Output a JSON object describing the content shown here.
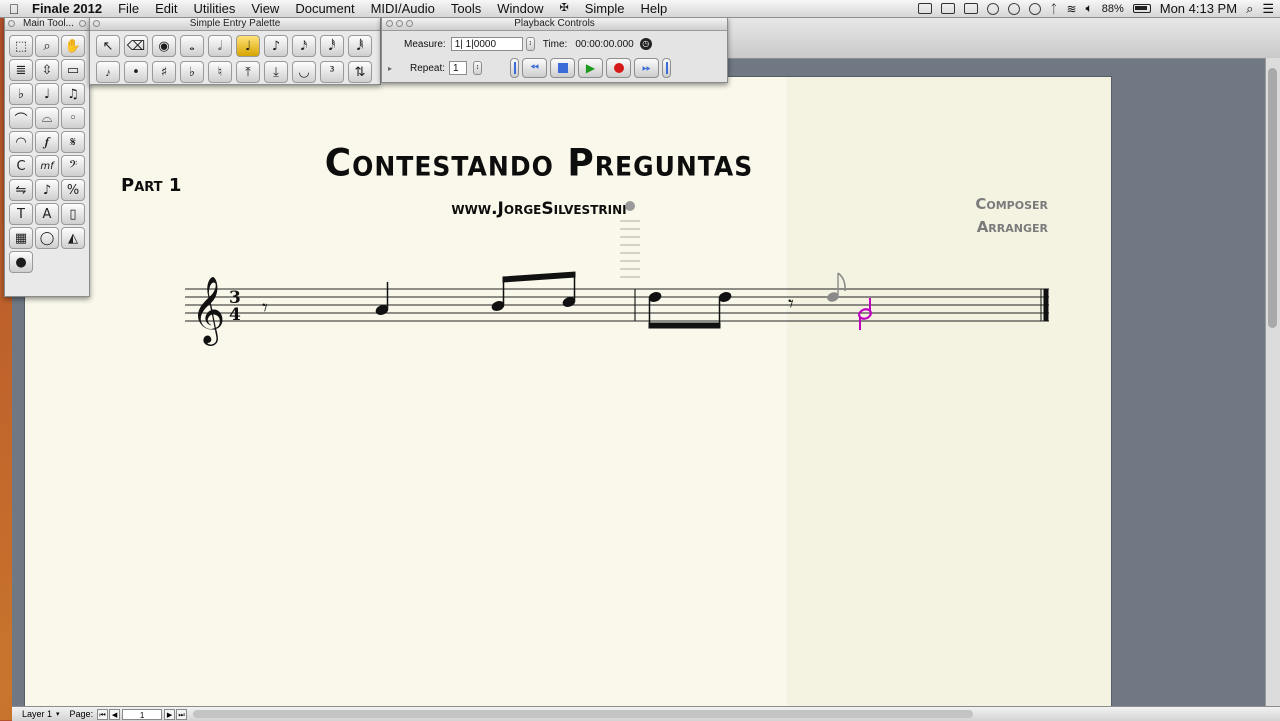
{
  "menubar": {
    "app_name": "Finale 2012",
    "items": [
      "File",
      "Edit",
      "Utilities",
      "View",
      "Document",
      "MIDI/Audio",
      "Tools",
      "Window",
      "Simple",
      "Help"
    ],
    "battery_percent": "88%",
    "clock": "Mon 4:13 PM"
  },
  "main_tool_palette": {
    "title": "Main Tool...",
    "tools": [
      {
        "icon": "selection-tool-icon",
        "glyph": "⬚"
      },
      {
        "icon": "zoom-tool-icon",
        "glyph": "⌕"
      },
      {
        "icon": "hand-grabber-icon",
        "glyph": "✋"
      },
      {
        "icon": "staff-tool-icon",
        "glyph": "≣"
      },
      {
        "icon": "resize-tool-icon",
        "glyph": "⇳"
      },
      {
        "icon": "measure-tool-icon",
        "glyph": "▭"
      },
      {
        "icon": "key-signature-icon",
        "glyph": "♭"
      },
      {
        "icon": "quarter-note-tool-icon",
        "glyph": "♩"
      },
      {
        "icon": "eighth-note-tool-icon",
        "glyph": "♫"
      },
      {
        "icon": "tuplet-tool-icon",
        "glyph": "⌒"
      },
      {
        "icon": "smart-shape-icon",
        "glyph": "⌓"
      },
      {
        "icon": "articulation-icon",
        "glyph": "◦"
      },
      {
        "icon": "slur-tool-icon",
        "glyph": "◠"
      },
      {
        "icon": "expression-tool-icon",
        "glyph": "𝆑"
      },
      {
        "icon": "repeat-tool-icon",
        "glyph": "𝄋"
      },
      {
        "icon": "chord-tool-icon",
        "glyph": "C"
      },
      {
        "icon": "mf-expression-icon",
        "glyph": "mf"
      },
      {
        "icon": "bass-clef-icon",
        "glyph": "𝄢"
      },
      {
        "icon": "mirror-tool-icon",
        "glyph": "⇋"
      },
      {
        "icon": "speedy-entry-icon",
        "glyph": "♪"
      },
      {
        "icon": "percent-tool-icon",
        "glyph": "%"
      },
      {
        "icon": "text-tool-icon",
        "glyph": "T"
      },
      {
        "icon": "lyrics-tool-icon",
        "glyph": "A"
      },
      {
        "icon": "page-layout-icon",
        "glyph": "▯"
      },
      {
        "icon": "midi-tool-icon",
        "glyph": "▦"
      },
      {
        "icon": "graphics-tool-icon",
        "glyph": "◯"
      },
      {
        "icon": "special-tools-icon",
        "glyph": "◭"
      },
      {
        "icon": "plugin-tool-icon",
        "glyph": "●"
      }
    ]
  },
  "simple_entry_palette": {
    "title": "Simple Entry Palette",
    "tools": [
      {
        "icon": "select-arrow-icon",
        "glyph": "↖"
      },
      {
        "icon": "eraser-icon",
        "glyph": "⌫"
      },
      {
        "icon": "eye-icon",
        "glyph": "◉"
      },
      {
        "icon": "whole-note-icon",
        "glyph": "𝅝"
      },
      {
        "icon": "half-note-icon",
        "glyph": "𝅗𝅥"
      },
      {
        "icon": "quarter-note-icon",
        "glyph": "♩",
        "active": true
      },
      {
        "icon": "eighth-note-icon",
        "glyph": "♪"
      },
      {
        "icon": "sixteenth-note-icon",
        "glyph": "𝅘𝅥𝅯"
      },
      {
        "icon": "thirty-second-note-icon",
        "glyph": "𝅘𝅥𝅰"
      },
      {
        "icon": "sixty-fourth-note-icon",
        "glyph": "𝅘𝅥𝅱"
      },
      {
        "icon": "grace-note-icon",
        "glyph": "𝆔"
      },
      {
        "icon": "dot-icon",
        "glyph": "•"
      },
      {
        "icon": "sharp-icon",
        "glyph": "♯"
      },
      {
        "icon": "flat-icon",
        "glyph": "♭"
      },
      {
        "icon": "natural-icon",
        "glyph": "♮"
      },
      {
        "icon": "raise-step-icon",
        "glyph": "⤒"
      },
      {
        "icon": "lower-step-icon",
        "glyph": "⤓"
      },
      {
        "icon": "tie-icon",
        "glyph": "◡"
      },
      {
        "icon": "tuplet-icon",
        "glyph": "³"
      },
      {
        "icon": "flip-stem-icon",
        "glyph": "⇅"
      }
    ]
  },
  "playback_controls": {
    "title": "Playback Controls",
    "measure_label": "Measure:",
    "measure_value": "1|  1|0000",
    "time_label": "Time:",
    "time_value": "00:00:00.000",
    "repeat_label": "Repeat:",
    "repeat_value": "1"
  },
  "score": {
    "title": "Contestando Preguntas",
    "subtitle": "www.JorgeSilvestrini",
    "part_name": "Part 1",
    "composer": "Composer",
    "arranger": "Arranger",
    "time_signature": {
      "top": "3",
      "bottom": "4"
    },
    "colors": {
      "ink": "#111111",
      "entry_note": "#c000c0",
      "cursor_note": "#8a8a8a"
    }
  },
  "statusbar": {
    "layer": "Layer 1",
    "page_label": "Page:",
    "page_value": "1"
  }
}
